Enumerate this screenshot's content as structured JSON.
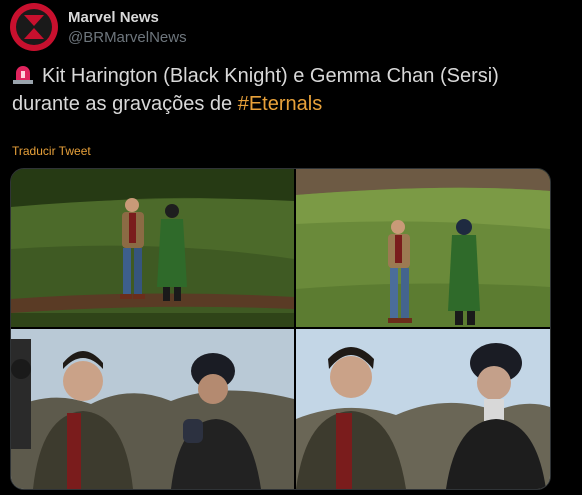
{
  "tweet": {
    "display_name": "Marvel News",
    "handle": "@BRMarvelNews",
    "text_before": "Kit Harington (Black Knight) e Gemma Chan (Sersi) durante as gravações de ",
    "hashtag": "#Eternals",
    "translate_label": "Traducir Tweet",
    "avatar_icon": "hourglass-logo-icon",
    "siren_icon": "rotating-light-emoji"
  },
  "colors": {
    "background": "#000000",
    "text": "#d9d9d9",
    "muted": "#6e767d",
    "link": "#e8a13a",
    "avatar": "#c8102e"
  },
  "media": {
    "photos": [
      {
        "subject": "couple-walking-night-park"
      },
      {
        "subject": "couple-walking-sunny-park"
      },
      {
        "subject": "closeup-couple-trees"
      },
      {
        "subject": "closeup-couple-sky"
      }
    ]
  }
}
